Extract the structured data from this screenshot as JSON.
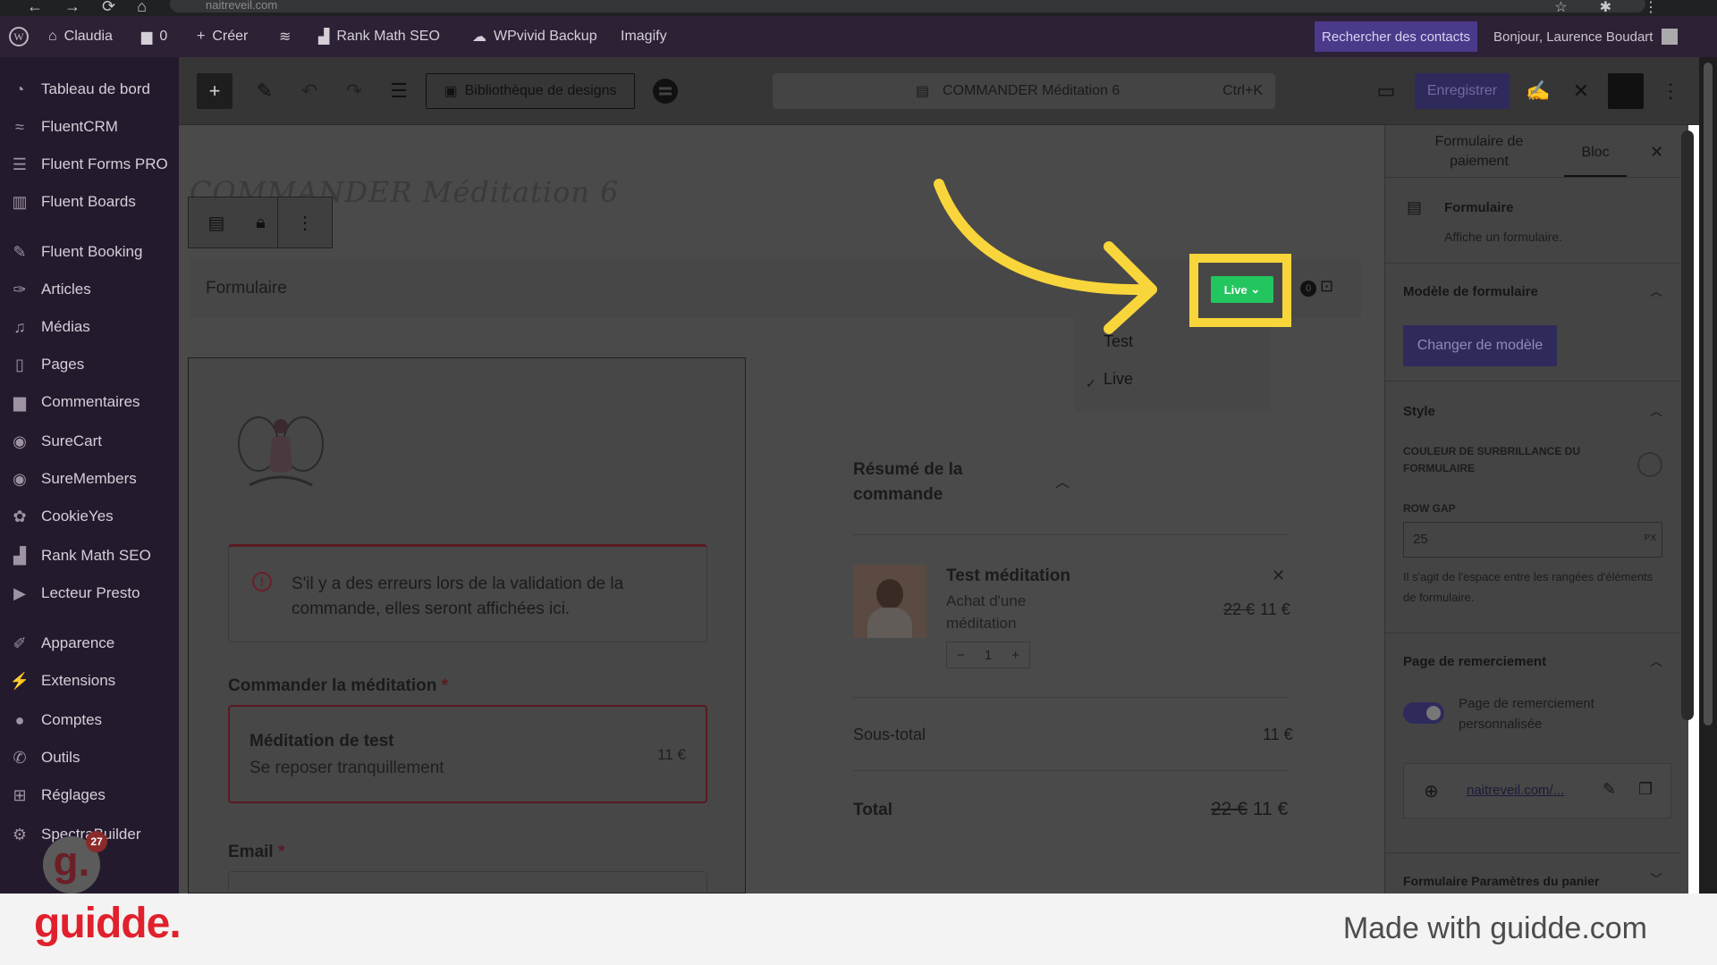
{
  "browser": {
    "url": "naitreveil.com"
  },
  "admin_bar": {
    "site": "Claudia",
    "comments": "0",
    "new": "Créer",
    "rankmath": "Rank Math SEO",
    "wpvivid": "WPvivid Backup",
    "imagify": "Imagify",
    "search": "Rechercher des contacts",
    "greeting": "Bonjour, Laurence Boudart"
  },
  "sidebar": {
    "items": [
      {
        "label": "Tableau de bord",
        "icon": "gauge-icon"
      },
      {
        "label": "FluentCRM",
        "icon": "fluentcrm-icon"
      },
      {
        "label": "Fluent Forms PRO",
        "icon": "forms-icon"
      },
      {
        "label": "Fluent Boards",
        "icon": "boards-icon"
      },
      {
        "label": "Fluent Booking",
        "icon": "booking-icon"
      },
      {
        "label": "Articles",
        "icon": "pin-icon"
      },
      {
        "label": "Médias",
        "icon": "media-icon"
      },
      {
        "label": "Pages",
        "icon": "pages-icon"
      },
      {
        "label": "Commentaires",
        "icon": "comment-icon"
      },
      {
        "label": "SureCart",
        "icon": "surecart-icon"
      },
      {
        "label": "SureMembers",
        "icon": "suremembers-icon"
      },
      {
        "label": "CookieYes",
        "icon": "cookie-icon"
      },
      {
        "label": "Rank Math SEO",
        "icon": "rankmath-icon"
      },
      {
        "label": "Lecteur Presto",
        "icon": "presto-icon"
      },
      {
        "label": "Apparence",
        "icon": "brush-icon"
      },
      {
        "label": "Extensions",
        "icon": "plugin-icon"
      },
      {
        "label": "Comptes",
        "icon": "user-icon"
      },
      {
        "label": "Outils",
        "icon": "wrench-icon"
      },
      {
        "label": "Réglages",
        "icon": "settings-icon"
      },
      {
        "label": "SpectraBuilder",
        "icon": "gear-icon"
      }
    ]
  },
  "toolbar": {
    "library": "Bibliothèque de designs",
    "doc_title": "COMMANDER Méditation 6",
    "shortcut": "Ctrl+K",
    "save": "Enregistrer"
  },
  "canvas": {
    "page_title": "COMMANDER Méditation 6",
    "form_block_label": "Formulaire",
    "mode_badge": "Live",
    "cart_count": "0",
    "mode_options": [
      "Test",
      "Live"
    ],
    "error_notice": "S'il y a des erreurs lors de la validation de la commande, elles seront affichées ici.",
    "order_label": "Commander la méditation",
    "required_mark": "*",
    "product_name": "Méditation de test",
    "product_sub": "Se reposer tranquillement",
    "product_price": "11 €",
    "email_label": "Email",
    "summary_title": "Résumé de la commande",
    "item_name": "Test méditation",
    "item_desc": "Achat d'une méditation",
    "item_old_price": "22 €",
    "item_price": "11 €",
    "item_qty": "1",
    "subtotal_label": "Sous-total",
    "subtotal_value": "11 €",
    "total_label": "Total",
    "total_old": "22 €",
    "total_value": "11 €"
  },
  "panel": {
    "tab_form": "Formulaire de paiement",
    "tab_block": "Bloc",
    "block_name": "Formulaire",
    "block_desc": "Affiche un formulaire.",
    "template_heading": "Modèle de formulaire",
    "change_template": "Changer de modèle",
    "style_heading": "Style",
    "highlight_label": "COULEUR DE SURBRILLANCE DU FORMULAIRE",
    "row_gap_label": "ROW GAP",
    "row_gap_value": "25",
    "row_gap_unit": "PX",
    "row_gap_help": "Il s'agit de l'espace entre les rangées d'éléments de formulaire.",
    "thanks_heading": "Page de remerciement",
    "thanks_toggle_label": "Page de remerciement personnalisée",
    "thanks_toggle_on": true,
    "thanks_url": "naitreveil.com/...",
    "cart_settings_heading": "Formulaire Paramètres du panier"
  },
  "bubble": {
    "letter": "g.",
    "count": "27"
  },
  "footer": {
    "brand": "guidde.",
    "made_with": "Made with guidde.com"
  },
  "colors": {
    "accent": "#22c55e",
    "highlight": "#f8d53a",
    "primary": "#2f2a5c",
    "brand": "#e0202c"
  }
}
